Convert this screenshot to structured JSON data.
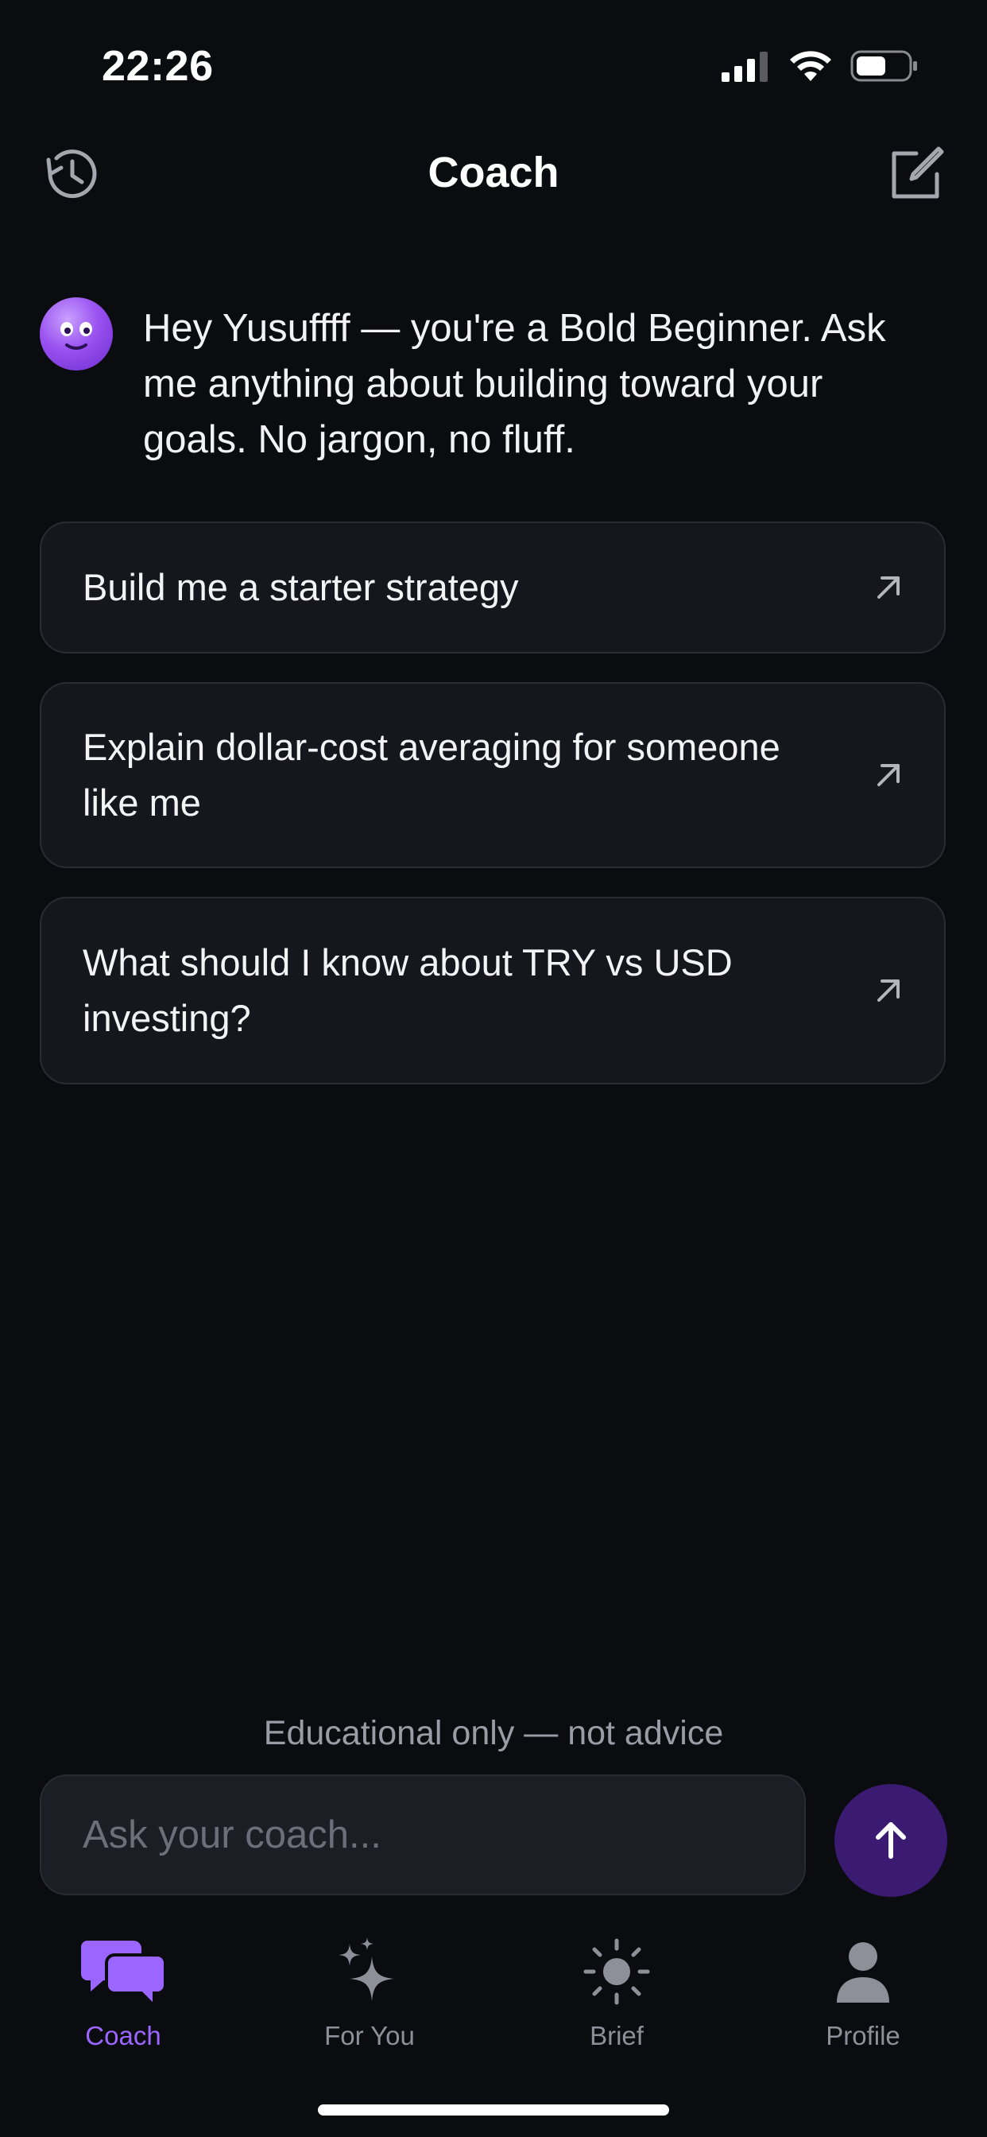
{
  "status": {
    "time": "22:26"
  },
  "header": {
    "title": "Coach"
  },
  "greeting": {
    "text": "Hey Yusuffff — you're a Bold Beginner. Ask me anything about building toward your goals. No jargon, no fluff."
  },
  "suggestions": [
    {
      "label": "Build me a starter strategy"
    },
    {
      "label": "Explain dollar-cost averaging for someone like me"
    },
    {
      "label": "What should I know about TRY vs USD investing?"
    }
  ],
  "disclaimer": "Educational only — not advice",
  "composer": {
    "placeholder": "Ask your coach..."
  },
  "tabs": [
    {
      "label": "Coach",
      "icon": "chat-bubbles-icon",
      "active": true
    },
    {
      "label": "For You",
      "icon": "sparkles-icon",
      "active": false
    },
    {
      "label": "Brief",
      "icon": "sun-icon",
      "active": false
    },
    {
      "label": "Profile",
      "icon": "person-icon",
      "active": false
    }
  ],
  "colors": {
    "background": "#0b0c10",
    "accent": "#9b66ff",
    "send_button": "#3b1a72",
    "card": "#15171d"
  }
}
